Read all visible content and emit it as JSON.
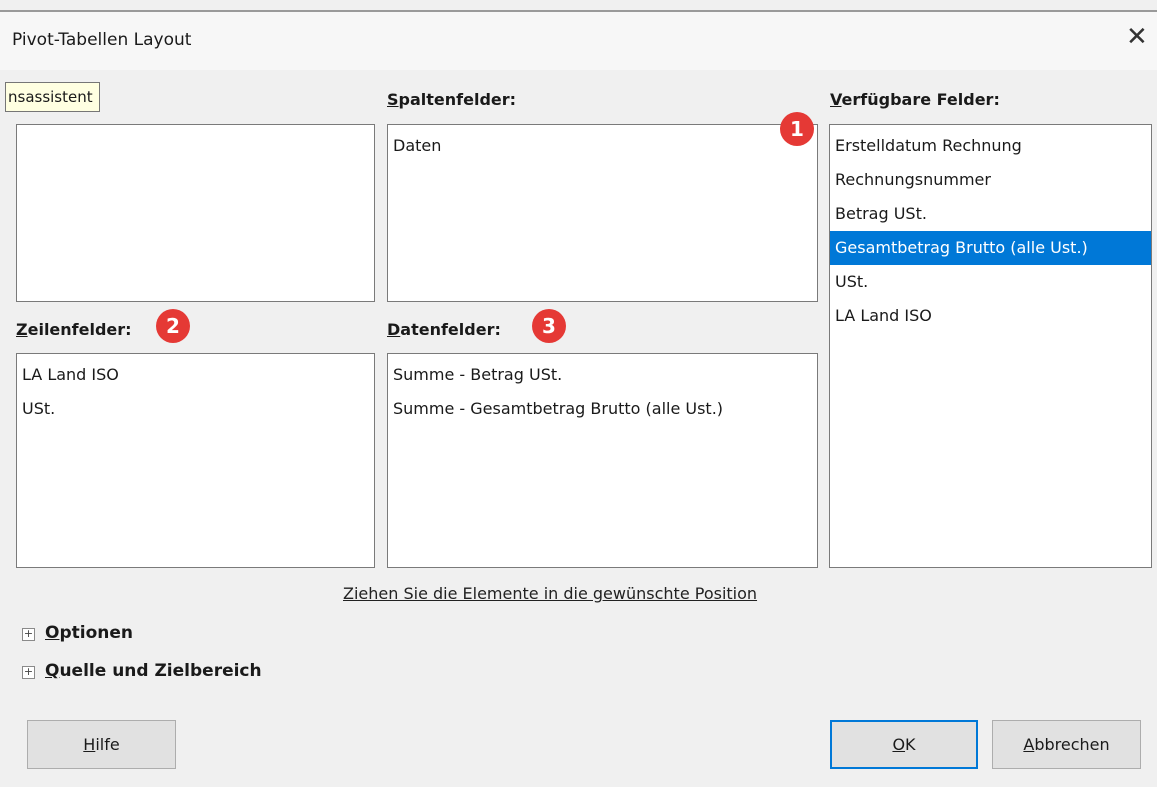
{
  "window": {
    "title": "Pivot-Tabellen Layout",
    "close_glyph": "✕"
  },
  "tooltip": "nsassistent",
  "column_fields": {
    "label_u": "S",
    "label_rest": "paltenfelder:",
    "items": [
      "Daten"
    ]
  },
  "available_fields": {
    "label_u": "V",
    "label_rest": "erfügbare Felder:",
    "items": [
      "Erstelldatum Rechnung",
      "Rechnungsnummer",
      "Betrag USt.",
      "Gesamtbetrag Brutto (alle Ust.)",
      "USt.",
      "LA Land ISO"
    ],
    "selected_index": 3
  },
  "row_fields": {
    "label_u": "Z",
    "label_rest": "eilenfelder:",
    "items": [
      "LA Land ISO",
      "USt."
    ]
  },
  "data_fields": {
    "label_u": "D",
    "label_rest": "atenfelder:",
    "items": [
      "Summe - Betrag USt.",
      "Summe - Gesamtbetrag Brutto (alle Ust.)"
    ]
  },
  "badges": [
    "1",
    "2",
    "3"
  ],
  "hint": "Ziehen Sie die Elemente in die gewünschte Position",
  "expanders": {
    "options": {
      "label_u": "O",
      "label_rest": "ptionen"
    },
    "source": {
      "label_u": "Q",
      "label_rest": "uelle und Zielbereich"
    }
  },
  "buttons": {
    "help": {
      "u": "H",
      "rest": "ilfe"
    },
    "ok": {
      "u": "O",
      "rest": "K"
    },
    "cancel": {
      "u": "A",
      "rest": "bbrechen"
    }
  },
  "colors": {
    "selection": "#0078d7",
    "badge": "#e53935",
    "tooltip_bg": "#ffffe1"
  }
}
